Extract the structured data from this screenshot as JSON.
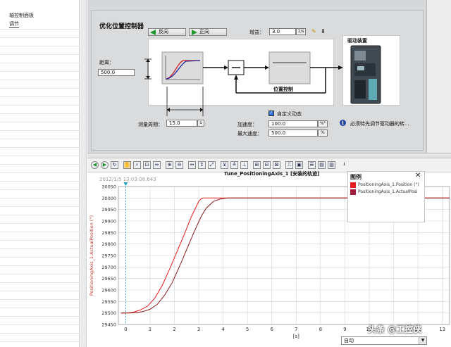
{
  "nav": {
    "title": "轴控制面板",
    "tune_item": "调节"
  },
  "panel": {
    "title": "优化位置控制器",
    "btn_reverse": "反向",
    "btn_forward": "正向",
    "gain_label": "增益：",
    "gain_value": "3.0",
    "gain_unit": "1/s",
    "distance_label": "距离：",
    "distance_value": "500.0",
    "measure_label": "测量周期：",
    "measure_value": "15.0",
    "measure_unit": "s",
    "position_control_label": "位置控制",
    "drive_label": "驱动装置",
    "custom_dynamic_label": "自定义动态",
    "custom_dynamic_checked": true,
    "accel_label": "加速度：",
    "accel_value": "100.0",
    "accel_unit": "%²",
    "maxspeed_label": "最大速度：",
    "maxspeed_value": "500.0",
    "maxspeed_unit": "%",
    "info_text": "必须特先调节驱动器的转..."
  },
  "chart_header": {
    "title": "Tune_PositioningAxis_1 [安装的轨迹]",
    "timestamp": "2012/1/5 13:03:08.643"
  },
  "legend": {
    "title": "图例",
    "items": [
      {
        "label": "PositioningAxis_1.Position (°)",
        "color": "#e01c1c"
      },
      {
        "label": "PositioningAxis_1.ActualPosi",
        "color": "#a21a3a"
      }
    ]
  },
  "combo": {
    "value": "自动"
  },
  "watermark": "头条 @工控侠",
  "colors": {
    "setpoint": "#e01c1c",
    "actual": "#8b1a1a",
    "ylabel": "#c0392b",
    "cursor": "#19a3c9"
  },
  "chart_data": {
    "type": "line",
    "ylabel": "PositioningAxis_1.ActualPosition (°)",
    "xlabel": "[s]",
    "xlim": [
      -0.3,
      13.3
    ],
    "ylim": [
      29450,
      30050
    ],
    "x_ticks": [
      "0",
      "1",
      "2",
      "3",
      "4",
      "5",
      "6",
      "7",
      "8",
      "9",
      "10",
      "11",
      "12",
      "13"
    ],
    "y_ticks": [
      "29450",
      "29500",
      "29550",
      "29600",
      "29650",
      "29700",
      "29750",
      "29800",
      "29850",
      "29900",
      "29950",
      "30000",
      "30050"
    ],
    "series": [
      {
        "name": "PositioningAxis_1.Position (°)",
        "x": [
          -0.2,
          0.0,
          0.3,
          0.6,
          0.9,
          1.2,
          1.5,
          1.8,
          2.1,
          2.4,
          2.7,
          3.0,
          3.1,
          3.2,
          13.3
        ],
        "y": [
          29500,
          29500,
          29503,
          29513,
          29530,
          29565,
          29620,
          29690,
          29765,
          29840,
          29920,
          29985,
          29997,
          30000,
          30000
        ]
      },
      {
        "name": "PositioningAxis_1.ActualPosition",
        "x": [
          -0.2,
          0.1,
          0.4,
          0.7,
          1.0,
          1.3,
          1.6,
          1.9,
          2.2,
          2.5,
          2.8,
          3.1,
          3.3,
          3.6,
          3.9,
          4.2,
          13.3
        ],
        "y": [
          29500,
          29500,
          29501,
          29506,
          29516,
          29538,
          29578,
          29630,
          29700,
          29775,
          29850,
          29920,
          29955,
          29985,
          29996,
          30000,
          30000
        ]
      }
    ],
    "cursor_x": 0.0,
    "grid": true
  }
}
